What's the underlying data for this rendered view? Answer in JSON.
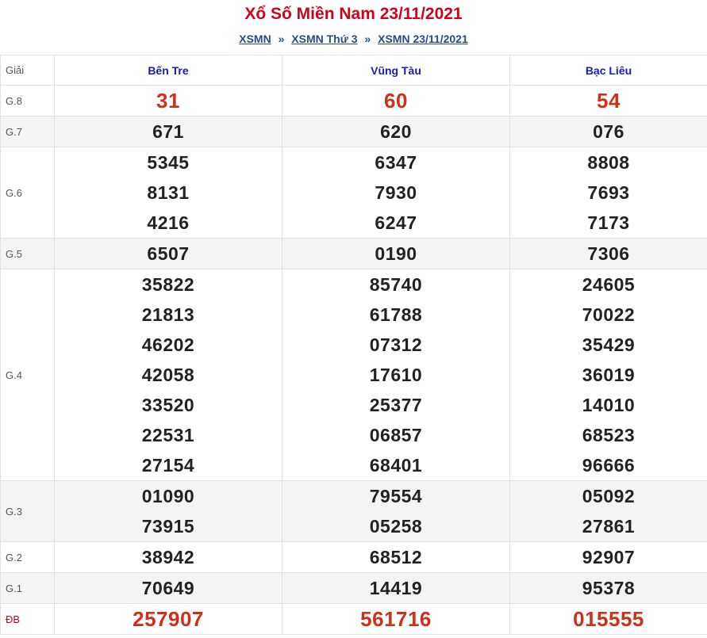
{
  "title": "Xổ Số Miền Nam 23/11/2021",
  "breadcrumb": {
    "items": [
      "XSMN",
      "XSMN Thứ 3",
      "XSMN 23/11/2021"
    ],
    "separator": "»"
  },
  "table": {
    "label_header": "Giải",
    "provinces": [
      "Bến Tre",
      "Vũng Tàu",
      "Bạc Liêu"
    ],
    "rows": [
      {
        "label": "G.8",
        "values": [
          [
            "31"
          ],
          [
            "60"
          ],
          [
            "54"
          ]
        ]
      },
      {
        "label": "G.7",
        "values": [
          [
            "671"
          ],
          [
            "620"
          ],
          [
            "076"
          ]
        ]
      },
      {
        "label": "G.6",
        "values": [
          [
            "5345",
            "8131",
            "4216"
          ],
          [
            "6347",
            "7930",
            "6247"
          ],
          [
            "8808",
            "7693",
            "7173"
          ]
        ]
      },
      {
        "label": "G.5",
        "values": [
          [
            "6507"
          ],
          [
            "0190"
          ],
          [
            "7306"
          ]
        ]
      },
      {
        "label": "G.4",
        "values": [
          [
            "35822",
            "21813",
            "46202",
            "42058",
            "33520",
            "22531",
            "27154"
          ],
          [
            "85740",
            "61788",
            "07312",
            "17610",
            "25377",
            "06857",
            "68401"
          ],
          [
            "24605",
            "70022",
            "35429",
            "36019",
            "14010",
            "68523",
            "96666"
          ]
        ]
      },
      {
        "label": "G.3",
        "values": [
          [
            "01090",
            "73915"
          ],
          [
            "79554",
            "05258"
          ],
          [
            "05092",
            "27861"
          ]
        ]
      },
      {
        "label": "G.2",
        "values": [
          [
            "38942"
          ],
          [
            "68512"
          ],
          [
            "92907"
          ]
        ]
      },
      {
        "label": "G.1",
        "values": [
          [
            "70649"
          ],
          [
            "14419"
          ],
          [
            "95378"
          ]
        ]
      },
      {
        "label": "ĐB",
        "values": [
          [
            "257907"
          ],
          [
            "561716"
          ],
          [
            "015555"
          ]
        ]
      }
    ]
  },
  "colors": {
    "title": "#d0021b",
    "breadcrumb_link": "#2a4a8a",
    "province_header": "#1b1bb0",
    "highlight_number": "#d0301a",
    "number": "#222222",
    "alt_row_bg": "#f4f4f4"
  }
}
